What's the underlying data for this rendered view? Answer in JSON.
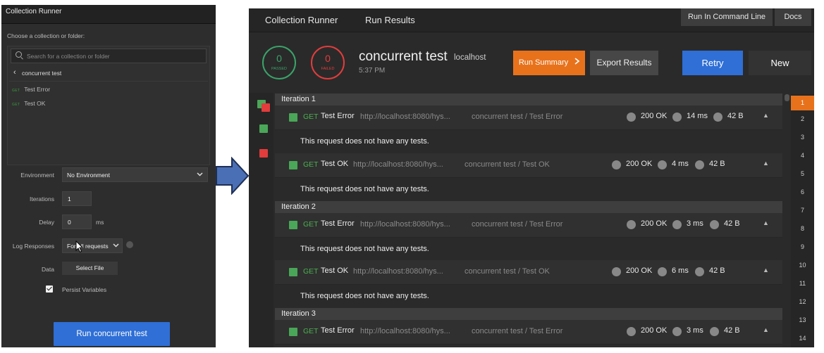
{
  "runner_panel": {
    "title": "Collection Runner",
    "choose_label": "Choose a collection or folder:",
    "search_placeholder": "Search for a collection or folder",
    "breadcrumb": "concurrent test",
    "requests": [
      {
        "method": "GET",
        "name": "Test Error"
      },
      {
        "method": "GET",
        "name": "Test OK"
      }
    ],
    "environment_label": "Environment",
    "environment_value": "No Environment",
    "iterations_label": "Iterations",
    "iterations_value": "1",
    "delay_label": "Delay",
    "delay_value": "0",
    "delay_unit": "ms",
    "log_label": "Log Responses",
    "log_value": "For all requests",
    "data_label": "Data",
    "select_file_label": "Select File",
    "persist_label": "Persist Variables",
    "run_button": "Run concurrent test"
  },
  "results": {
    "tabs": [
      "Collection Runner",
      "Run Results"
    ],
    "cmd_button": "Run In Command Line",
    "docs_button": "Docs",
    "passed_count": "0",
    "passed_label": "PASSED",
    "failed_count": "0",
    "failed_label": "FAILED",
    "run_name": "concurrent test",
    "environment": "localhost",
    "time": "5:37 PM",
    "summary_button": "Run Summary",
    "export_button": "Export Results",
    "retry_button": "Retry",
    "new_button": "New",
    "no_tests_message": "This request does not have any tests.",
    "iterations": [
      {
        "label": "Iteration 1",
        "requests": [
          {
            "method": "GET",
            "name": "Test Error",
            "url": "http://localhost:8080/hys...",
            "path": "concurrent test / Test Error",
            "status": "200 OK",
            "time": "14 ms",
            "size": "42 B"
          },
          {
            "method": "GET",
            "name": "Test OK",
            "url": "http://localhost:8080/hys...",
            "path": "concurrent test / Test OK",
            "status": "200 OK",
            "time": "4 ms",
            "size": "42 B"
          }
        ]
      },
      {
        "label": "Iteration 2",
        "requests": [
          {
            "method": "GET",
            "name": "Test Error",
            "url": "http://localhost:8080/hys...",
            "path": "concurrent test / Test Error",
            "status": "200 OK",
            "time": "3 ms",
            "size": "42 B"
          },
          {
            "method": "GET",
            "name": "Test OK",
            "url": "http://localhost:8080/hys...",
            "path": "concurrent test / Test OK",
            "status": "200 OK",
            "time": "6 ms",
            "size": "42 B"
          }
        ]
      },
      {
        "label": "Iteration 3",
        "requests": [
          {
            "method": "GET",
            "name": "Test Error",
            "url": "http://localhost:8080/hys...",
            "path": "concurrent test / Test Error",
            "status": "200 OK",
            "time": "3 ms",
            "size": "42 B"
          }
        ]
      }
    ],
    "iteration_numbers": [
      "1",
      "2",
      "3",
      "4",
      "5",
      "6",
      "7",
      "8",
      "9",
      "10",
      "11",
      "12",
      "13",
      "14"
    ],
    "selected_iteration": "1"
  },
  "colors": {
    "accent_orange": "#e8721c",
    "retry_blue": "#2f6fd6",
    "pass_green": "#4aa658",
    "fail_red": "#e23c3c"
  }
}
